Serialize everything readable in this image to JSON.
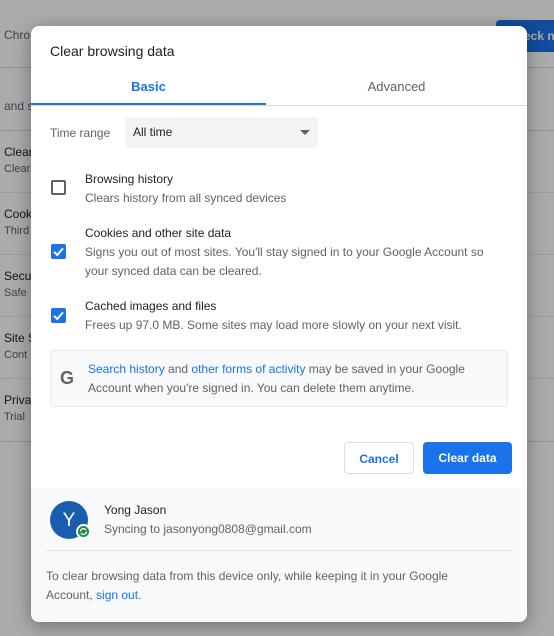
{
  "background": {
    "header_text": "Chro",
    "check_button": "eck n",
    "section_label": "and s",
    "rows": [
      {
        "title": "Clear",
        "subtitle": "Clear"
      },
      {
        "title": "Cook",
        "subtitle": "Third"
      },
      {
        "title": "Secu",
        "subtitle": "Safe"
      },
      {
        "title": "Site S",
        "subtitle": "Cont"
      },
      {
        "title": "Priva",
        "subtitle": "Trial"
      }
    ]
  },
  "dialog": {
    "title": "Clear browsing data",
    "tabs": {
      "basic": "Basic",
      "advanced": "Advanced",
      "selected": "Basic"
    },
    "time_range": {
      "label": "Time range",
      "value": "All time"
    },
    "options": [
      {
        "title": "Browsing history",
        "description": "Clears history from all synced devices",
        "checked": false
      },
      {
        "title": "Cookies and other site data",
        "description_line1": "Signs you out of most sites. You'll stay signed in to your Google Account so",
        "description_line2": "your synced data can be cleared.",
        "checked": true
      },
      {
        "title": "Cached images and files",
        "description": "Frees up 97.0 MB. Some sites may load more slowly on your next visit.",
        "checked": true
      }
    ],
    "info": {
      "icon": "google-g-icon",
      "link1": "Search history",
      "text1": " and ",
      "link2": "other forms of activity",
      "text2": " may be saved in your Google",
      "line2": "Account when you're signed in. You can delete them anytime."
    },
    "buttons": {
      "cancel": "Cancel",
      "clear": "Clear data"
    },
    "account": {
      "avatar_initial": "Y",
      "name": "Yong Jason",
      "sync_status": "Syncing to jasonyong0808@gmail.com"
    },
    "footer_note": {
      "line1": "To clear browsing data from this device only, while keeping it in your Google",
      "line2_prefix": "Account, ",
      "link": "sign out",
      "line2_suffix": "."
    }
  },
  "colors": {
    "accent": "#1a73e8",
    "avatar": "#1a5cad",
    "sync_badge": "#1e8e3e"
  }
}
